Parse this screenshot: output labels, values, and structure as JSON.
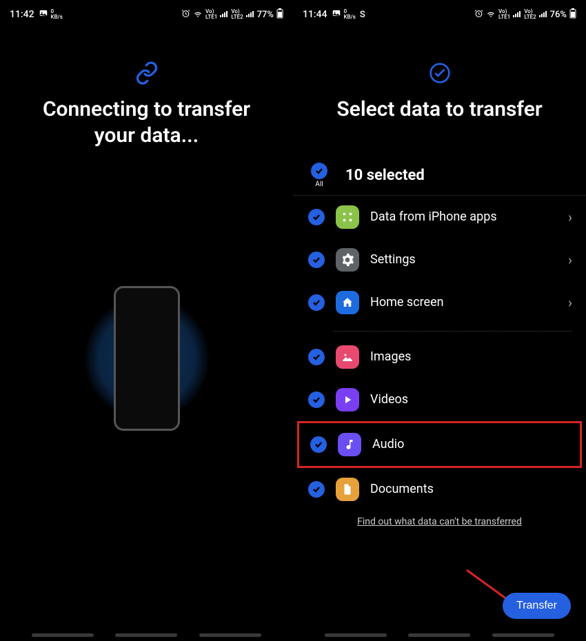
{
  "left": {
    "status": {
      "time": "11:42",
      "kbs_top": "0",
      "kbs_bottom": "KB/s",
      "lte1_top": "Vo)",
      "lte1_bottom": "LTE1",
      "lte2_top": "Vo)",
      "lte2_bottom": "LTE2",
      "battery": "77%"
    },
    "title": "Connecting to transfer your data..."
  },
  "right": {
    "status": {
      "time": "11:44",
      "kbs_top": "0",
      "kbs_bottom": "KB/s",
      "s_badge": "S",
      "lte1_top": "Vo)",
      "lte1_bottom": "LTE1",
      "lte2_top": "Vo)",
      "lte2_bottom": "LTE2",
      "battery": "76%"
    },
    "title": "Select data to transfer",
    "all_label": "All",
    "selected_count": "10 selected",
    "items": {
      "iphone_apps": "Data from iPhone apps",
      "settings": "Settings",
      "home_screen": "Home screen",
      "images": "Images",
      "videos": "Videos",
      "audio": "Audio",
      "documents": "Documents"
    },
    "find_out": "Find out what data can't be transferred",
    "transfer_btn": "Transfer"
  }
}
